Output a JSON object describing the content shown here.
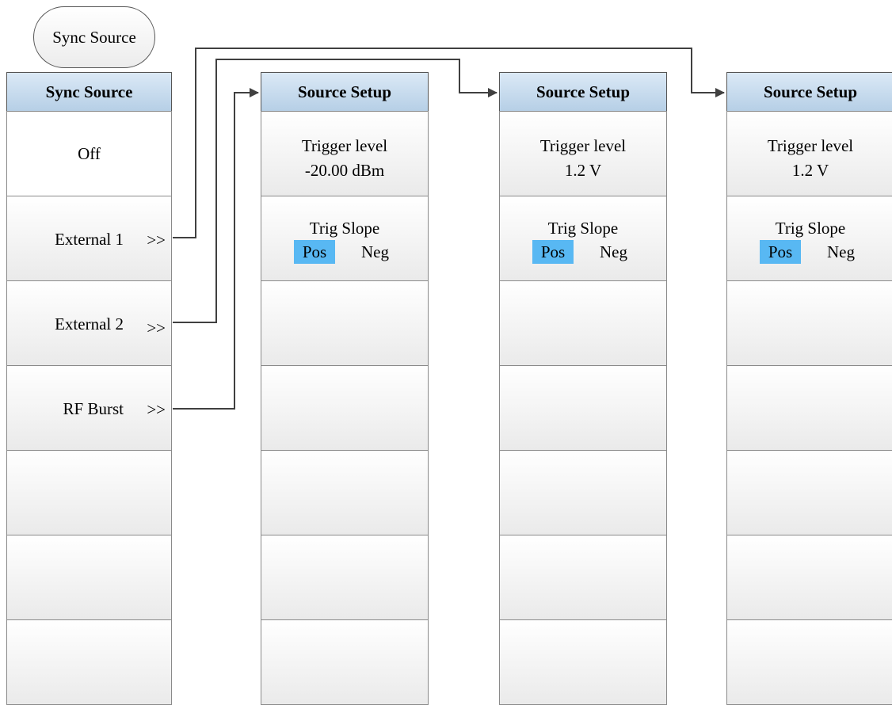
{
  "hardkey": {
    "label": "Sync Source"
  },
  "sync_menu": {
    "title": "Sync Source",
    "items": [
      {
        "label": "Off"
      },
      {
        "label": "External 1",
        "arrow": ">>"
      },
      {
        "label": "External 2",
        "arrow": ">>"
      },
      {
        "label": "RF Burst",
        "arrow": ">>"
      }
    ]
  },
  "setup_menus": [
    {
      "title": "Source Setup",
      "trigger_label": "Trigger level",
      "trigger_value": "-20.00 dBm",
      "slope_label": "Trig Slope",
      "slope_pos": "Pos",
      "slope_neg": "Neg",
      "selected_slope": "Pos"
    },
    {
      "title": "Source Setup",
      "trigger_label": "Trigger level",
      "trigger_value": "1.2 V",
      "slope_label": "Trig Slope",
      "slope_pos": "Pos",
      "slope_neg": "Neg",
      "selected_slope": "Pos"
    },
    {
      "title": "Source Setup",
      "trigger_label": "Trigger level",
      "trigger_value": "1.2 V",
      "slope_label": "Trig Slope",
      "slope_pos": "Pos",
      "slope_neg": "Neg",
      "selected_slope": "Pos"
    }
  ],
  "colors": {
    "header": "#b6cfe6",
    "selected": "#58b8f3",
    "connector": "#404040"
  }
}
